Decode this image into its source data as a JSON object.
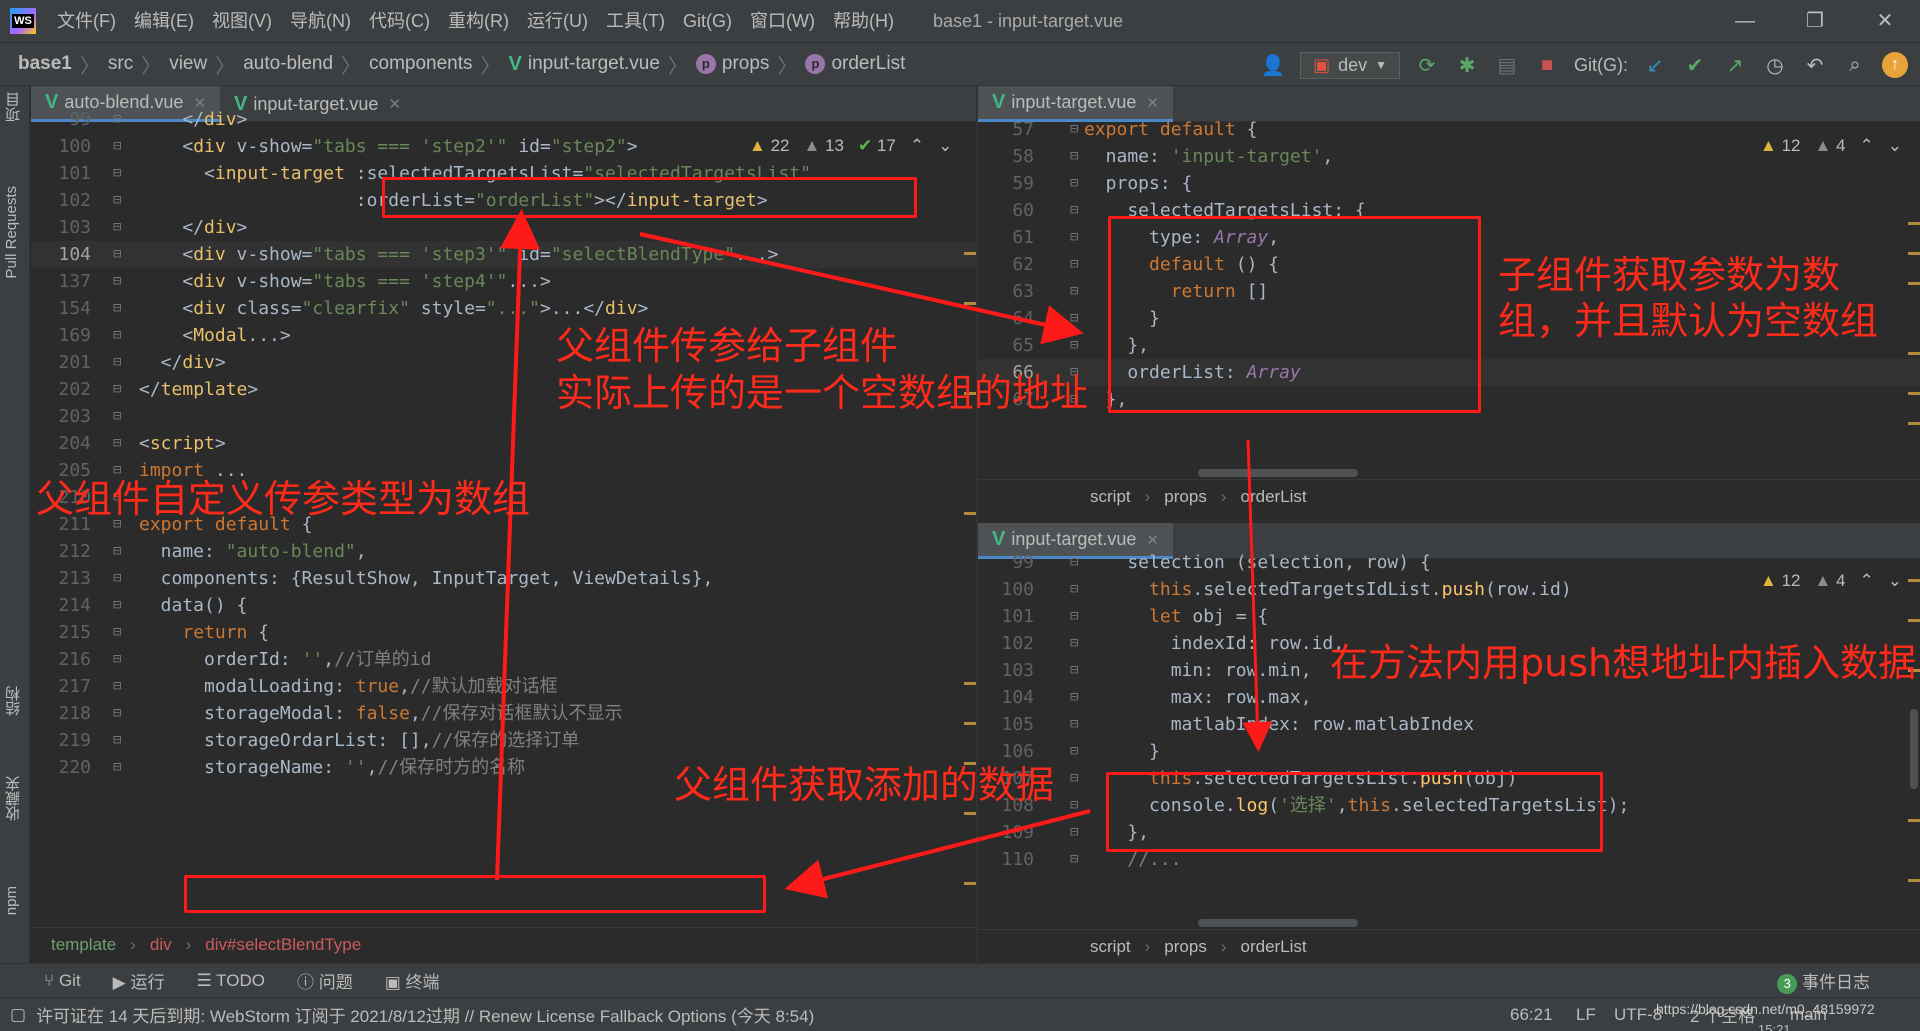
{
  "titlebar": {
    "logo": "WS",
    "menu": [
      "文件(F)",
      "编辑(E)",
      "视图(V)",
      "导航(N)",
      "代码(C)",
      "重构(R)",
      "运行(U)",
      "工具(T)",
      "Git(G)",
      "窗口(W)",
      "帮助(H)"
    ],
    "title": "base1 - input-target.vue",
    "controls": [
      "—",
      "❐",
      "✕"
    ]
  },
  "navbar": {
    "crumbs": [
      "base1",
      "src",
      "view",
      "auto-blend",
      "components",
      "input-target.vue",
      "props",
      "orderList"
    ],
    "run_config": "dev",
    "git_label": "Git(G):"
  },
  "left_stripe": [
    "项目",
    "Pull Requests",
    "结构",
    "收藏夹",
    "npm"
  ],
  "left_editor": {
    "tabs": [
      {
        "label": "auto-blend.vue",
        "active": true
      },
      {
        "label": "input-target.vue",
        "active": false
      }
    ],
    "warnings": {
      "warn": "22",
      "weak": "13",
      "ok": "17"
    },
    "lines": [
      {
        "n": "99",
        "t": "    </div>"
      },
      {
        "n": "100",
        "t": "    <div v-show=\"tabs === 'step2'\" id=\"step2\">"
      },
      {
        "n": "101",
        "t": "      <input-target :selectedTargetsList=\"selectedTargetsList\""
      },
      {
        "n": "102",
        "t": "                    :orderList=\"orderList\"></input-target>"
      },
      {
        "n": "103",
        "t": "    </div>"
      },
      {
        "n": "104",
        "t": "    <div v-show=\"tabs === 'step3'\" id=\"selectBlendType\"...>"
      },
      {
        "n": "137",
        "t": "    <div v-show=\"tabs === 'step4'\"...>"
      },
      {
        "n": "154",
        "t": "    <div class=\"clearfix\" style=\"...\">...</div>"
      },
      {
        "n": "169",
        "t": "    <Modal...>"
      },
      {
        "n": "201",
        "t": "  </div>"
      },
      {
        "n": "202",
        "t": "</template>"
      },
      {
        "n": "203",
        "t": ""
      },
      {
        "n": "204",
        "t": "<script>"
      },
      {
        "n": "205",
        "t": "import ..."
      },
      {
        "n": "210",
        "t": ""
      },
      {
        "n": "211",
        "t": "export default {"
      },
      {
        "n": "212",
        "t": "  name: \"auto-blend\","
      },
      {
        "n": "213",
        "t": "  components: {ResultShow, InputTarget, ViewDetails},"
      },
      {
        "n": "214",
        "t": "  data() {"
      },
      {
        "n": "215",
        "t": "    return {"
      },
      {
        "n": "216",
        "t": "      orderId: '',//订单的id"
      },
      {
        "n": "217",
        "t": "      modalLoading: true,//默认加载对话框"
      },
      {
        "n": "218",
        "t": "      storageModal: false,//保存对话框默认不显示"
      },
      {
        "n": "219",
        "t": "      storageOrdarList: [],//保存的选择订单"
      },
      {
        "n": "220",
        "t": "      storageName: '',//保存时方的名称"
      }
    ],
    "crumbs": [
      "template",
      "div",
      "div#selectBlendType"
    ]
  },
  "right_top_editor": {
    "tabs": [
      {
        "label": "input-target.vue",
        "active": true
      }
    ],
    "warnings": {
      "warn": "12",
      "weak": "4"
    },
    "lines": [
      {
        "n": "57",
        "t": "export default {"
      },
      {
        "n": "58",
        "t": "  name: 'input-target',"
      },
      {
        "n": "59",
        "t": "  props: {"
      },
      {
        "n": "60",
        "t": "    selectedTargetsList: {"
      },
      {
        "n": "61",
        "t": "      type: Array,"
      },
      {
        "n": "62",
        "t": "      default () {"
      },
      {
        "n": "63",
        "t": "        return []"
      },
      {
        "n": "64",
        "t": "      }"
      },
      {
        "n": "65",
        "t": "    },"
      },
      {
        "n": "66",
        "t": "    orderList: Array"
      },
      {
        "n": "67",
        "t": "  },"
      }
    ],
    "crumbs": [
      "script",
      "props",
      "orderList"
    ]
  },
  "right_bottom_editor": {
    "tabs": [
      {
        "label": "input-target.vue",
        "active": true
      }
    ],
    "warnings": {
      "warn": "12",
      "weak": "4"
    },
    "lines": [
      {
        "n": "99",
        "t": "    selection (selection, row) {"
      },
      {
        "n": "100",
        "t": "      this.selectedTargetsIdList.push(row.id)"
      },
      {
        "n": "101",
        "t": "      let obj = {"
      },
      {
        "n": "102",
        "t": "        indexId: row.id,"
      },
      {
        "n": "103",
        "t": "        min: row.min,"
      },
      {
        "n": "104",
        "t": "        max: row.max,"
      },
      {
        "n": "105",
        "t": "        matlabIndex: row.matlabIndex"
      },
      {
        "n": "106",
        "t": "      }"
      },
      {
        "n": "107",
        "t": "      this.selectedTargetsList.push(obj)"
      },
      {
        "n": "108",
        "t": "      console.log('选择',this.selectedTargetsList);"
      },
      {
        "n": "109",
        "t": "    },"
      },
      {
        "n": "110",
        "t": "    //..."
      }
    ],
    "crumbs": [
      "script",
      "props",
      "orderList"
    ]
  },
  "toolstrip": [
    "Git",
    "运行",
    "TODO",
    "问题",
    "终端"
  ],
  "event_log": {
    "count": "3",
    "label": "事件日志"
  },
  "statusbar": {
    "message": "许可证在 14 天后到期: WebStorm 订阅于 2021/8/12过期 // Renew License   Fallback Options (今天 8:54)",
    "position": "66:21",
    "line_sep": "LF",
    "encoding": "UTF-8",
    "indent": "2 个空格",
    "branch": "main",
    "watermark": "https://blog.csdn.net/m0_48159972",
    "time": "15:21"
  },
  "annotations": {
    "parent_custom_type": "父组件自定义传参类型为数组",
    "parent_pass_line1": "父组件传参给子组件",
    "parent_pass_line2": "实际上传的是一个空数组的地址",
    "child_receive_line1": "子组件获取参数为数",
    "child_receive_line2": "组，并且默认为空数组",
    "push_in_method": "在方法内用push想地址内插入数据",
    "parent_get_added": "父组件获取添加的数据"
  },
  "colors": {
    "annotation": "#ff2a1a",
    "background": "#2b2b2b",
    "panel": "#3c3f41"
  }
}
